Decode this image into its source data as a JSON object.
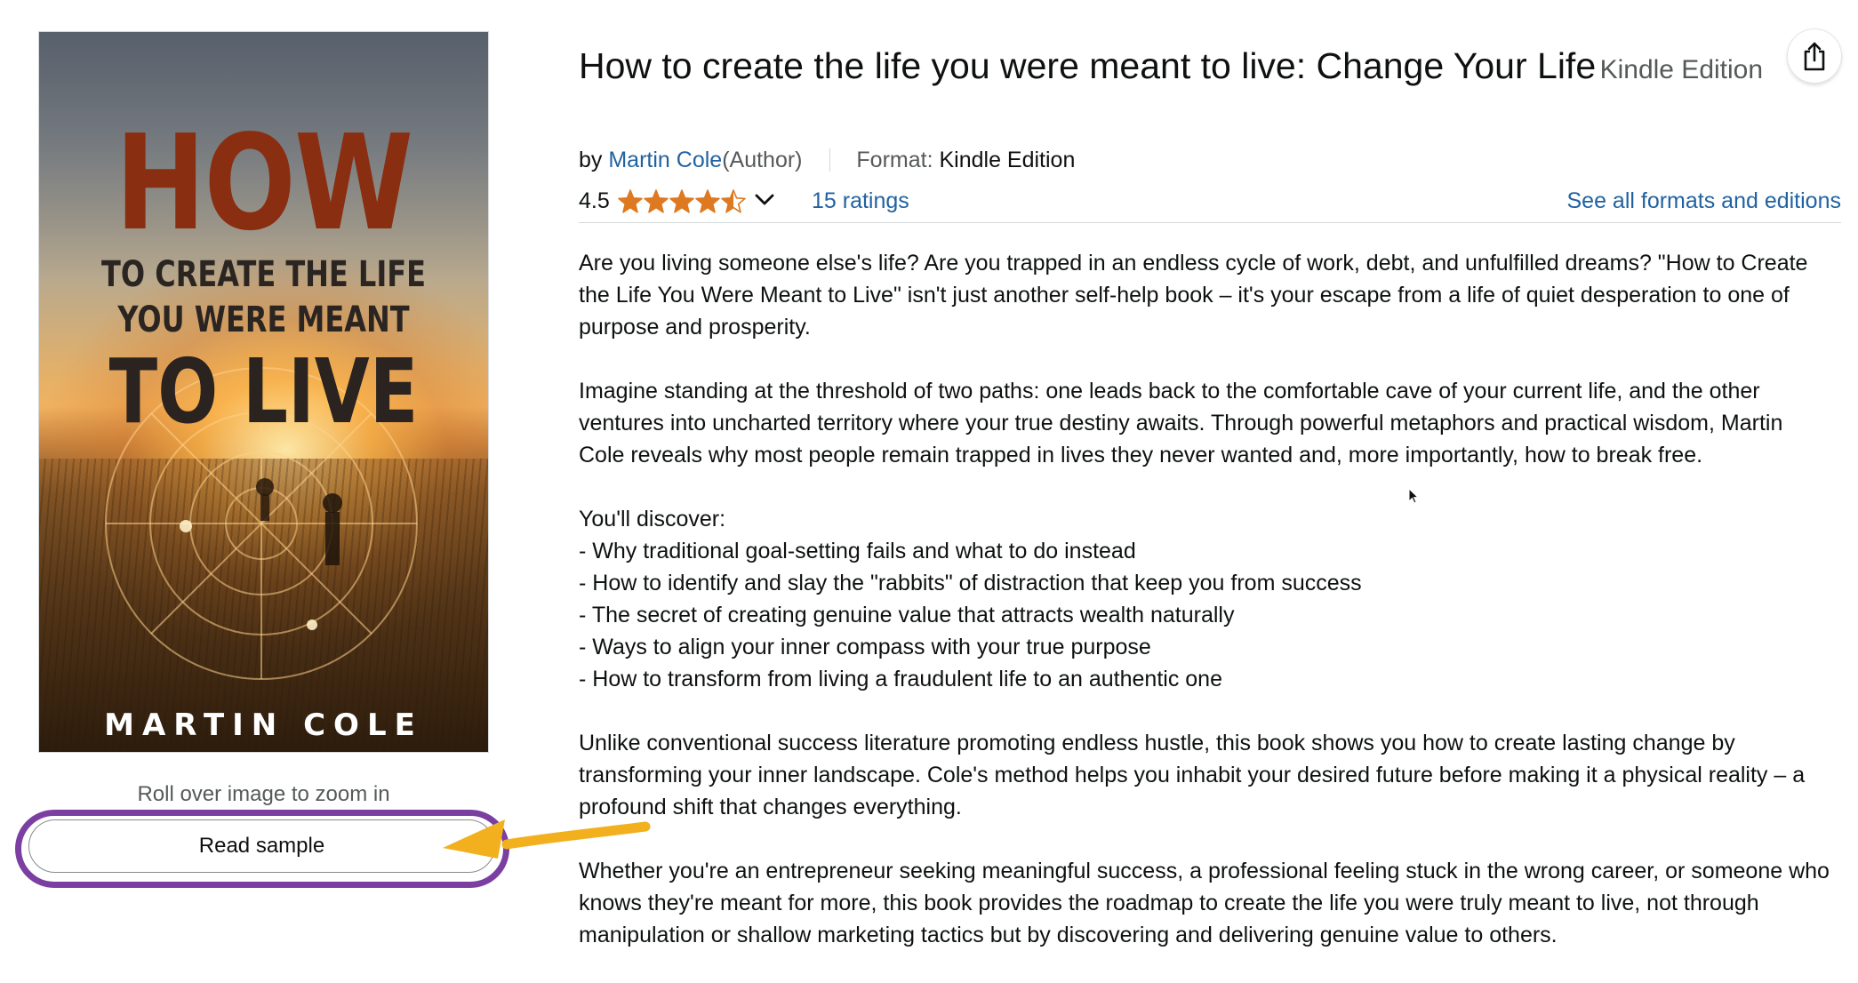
{
  "cover": {
    "title_big": "HOW",
    "subtitle_line1": "TO CREATE THE LIFE",
    "subtitle_line2": "YOU WERE MEANT",
    "subtitle_line3": "TO LIVE",
    "author": "MARTIN COLE"
  },
  "zoom_hint": "Roll over image to zoom in",
  "read_sample_label": "Read sample",
  "product": {
    "title": "How to create the life you were meant to live: Change Your Life",
    "format_label": "Kindle Edition",
    "byline_prefix": "by",
    "author_name": "Martin Cole",
    "author_role": "(Author)",
    "format_prefix": "Format:",
    "format_value": "Kindle Edition",
    "rating_value": "4.5",
    "rating_stars": 4.5,
    "ratings_count": "15 ratings",
    "see_all_formats": "See all formats and editions"
  },
  "description": {
    "p1": "Are you living someone else's life? Are you trapped in an endless cycle of work, debt, and unfulfilled dreams? \"How to Create the Life You Were Meant to Live\" isn't just another self-help book – it's your escape from a life of quiet desperation to one of purpose and prosperity.",
    "p2": "Imagine standing at the threshold of two paths: one leads back to the comfortable cave of your current life, and the other ventures into uncharted territory where your true destiny awaits. Through powerful metaphors and practical wisdom, Martin Cole reveals why most people remain trapped in lives they never wanted and, more importantly, how to break free.",
    "list_intro": "You'll discover:",
    "list": [
      "- Why traditional goal-setting fails and what to do instead",
      "- How to identify and slay the \"rabbits\" of distraction that keep you from success",
      "- The secret of creating genuine value that attracts wealth naturally",
      "- Ways to align your inner compass with your true purpose",
      "- How to transform from living a fraudulent life to an authentic one"
    ],
    "p3": "Unlike conventional success literature promoting endless hustle, this book shows you how to create lasting change by transforming your inner landscape. Cole's method helps you inhabit your desired future before making it a physical reality – a profound shift that changes everything.",
    "p4": "Whether you're an entrepreneur seeking meaningful success, a professional feeling stuck in the wrong career, or someone who knows they're meant for more, this book provides the roadmap to create the life you were truly meant to live, not through manipulation or shallow marketing tactics but by discovering and delivering genuine value to others."
  },
  "colors": {
    "link": "#2162a1",
    "star": "#de7921",
    "highlight_oval": "#7a3fa0",
    "annotation_arrow": "#f2b01e"
  },
  "icons": {
    "share": "share-icon",
    "chevron": "chevron-down-icon",
    "stars": "star-rating-icon"
  }
}
